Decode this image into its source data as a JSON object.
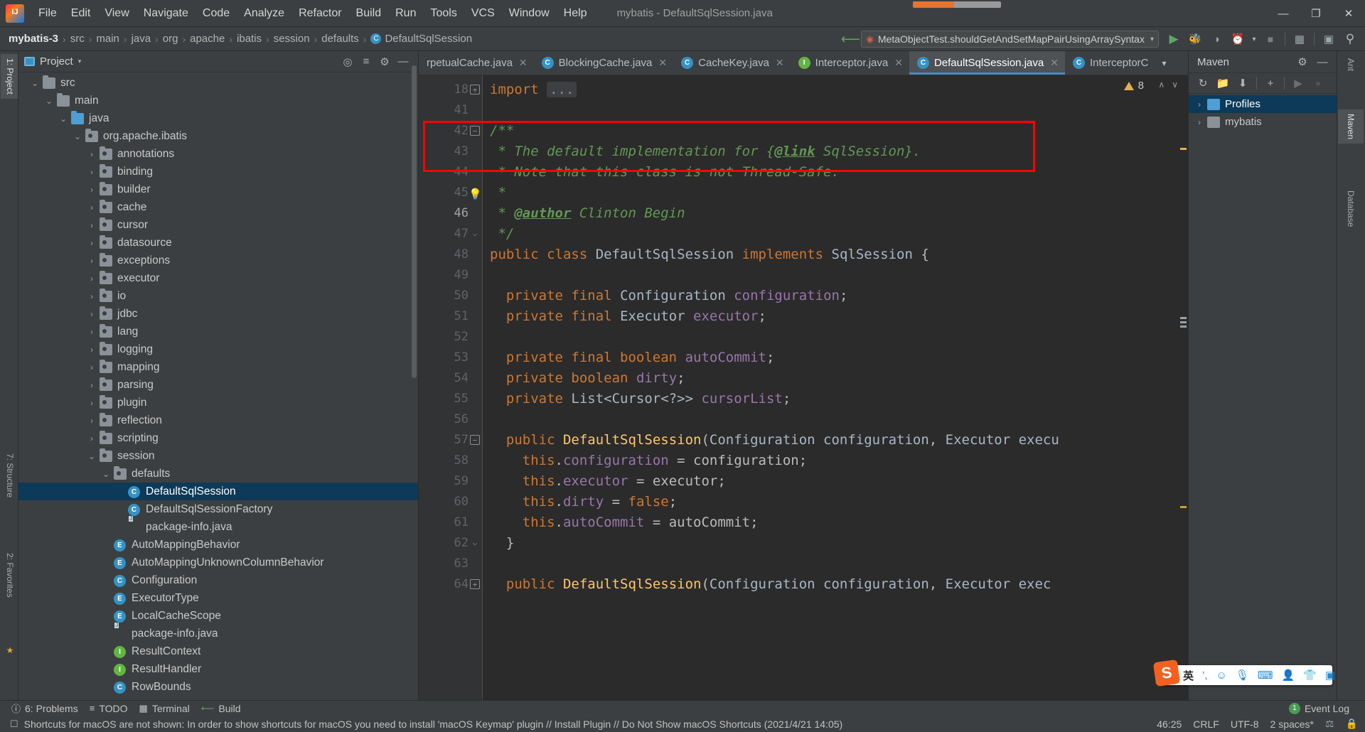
{
  "window": {
    "title": "mybatis - DefaultSqlSession.java",
    "buttons": {
      "minimize": "—",
      "maximize": "❐",
      "close": "✕"
    }
  },
  "menu": {
    "items": [
      "File",
      "Edit",
      "View",
      "Navigate",
      "Code",
      "Analyze",
      "Refactor",
      "Build",
      "Run",
      "Tools",
      "VCS",
      "Window",
      "Help"
    ]
  },
  "breadcrumb": {
    "items": [
      "mybatis-3",
      "src",
      "main",
      "java",
      "org",
      "apache",
      "ibatis",
      "session",
      "defaults",
      "DefaultSqlSession"
    ],
    "separator": "›",
    "class_badge": "C"
  },
  "run_config": {
    "name": "MetaObjectTest.shouldGetAndSetMapPairUsingArraySyntax",
    "caret": "▾"
  },
  "toolbar": {
    "run": "▶",
    "debug": "debug-bug-icon",
    "coverage": "run-with-coverage-icon",
    "profiler": "profiler-icon",
    "profiler_caret": "▾",
    "stop": "■",
    "project_structure": "project-structure-icon",
    "presentation": "▶",
    "search": "⌕"
  },
  "left_strip": {
    "tabs": [
      {
        "label": "1: Project",
        "active": true
      },
      {
        "label": "7: Structure",
        "active": false
      },
      {
        "label": "2: Favorites",
        "active": false
      },
      {
        "label": "★",
        "active": false
      }
    ]
  },
  "project_panel": {
    "title": "Project",
    "caret": "▾",
    "actions": [
      "target-icon",
      "collapse-all-icon",
      "settings-gear-icon",
      "hide-icon"
    ],
    "tree": [
      {
        "indent": 1,
        "arrow": "⌄",
        "icon": "folder",
        "label": "src",
        "type": "folder"
      },
      {
        "indent": 2,
        "arrow": "⌄",
        "icon": "folder",
        "label": "main",
        "type": "folder"
      },
      {
        "indent": 3,
        "arrow": "⌄",
        "icon": "folder-blue",
        "label": "java",
        "type": "folder-blue"
      },
      {
        "indent": 4,
        "arrow": "⌄",
        "icon": "package",
        "label": "org.apache.ibatis",
        "type": "package"
      },
      {
        "indent": 5,
        "arrow": "›",
        "icon": "package",
        "label": "annotations",
        "type": "package"
      },
      {
        "indent": 5,
        "arrow": "›",
        "icon": "package",
        "label": "binding",
        "type": "package"
      },
      {
        "indent": 5,
        "arrow": "›",
        "icon": "package",
        "label": "builder",
        "type": "package"
      },
      {
        "indent": 5,
        "arrow": "›",
        "icon": "package",
        "label": "cache",
        "type": "package"
      },
      {
        "indent": 5,
        "arrow": "›",
        "icon": "package",
        "label": "cursor",
        "type": "package"
      },
      {
        "indent": 5,
        "arrow": "›",
        "icon": "package",
        "label": "datasource",
        "type": "package"
      },
      {
        "indent": 5,
        "arrow": "›",
        "icon": "package",
        "label": "exceptions",
        "type": "package"
      },
      {
        "indent": 5,
        "arrow": "›",
        "icon": "package",
        "label": "executor",
        "type": "package"
      },
      {
        "indent": 5,
        "arrow": "›",
        "icon": "package",
        "label": "io",
        "type": "package"
      },
      {
        "indent": 5,
        "arrow": "›",
        "icon": "package",
        "label": "jdbc",
        "type": "package"
      },
      {
        "indent": 5,
        "arrow": "›",
        "icon": "package",
        "label": "lang",
        "type": "package"
      },
      {
        "indent": 5,
        "arrow": "›",
        "icon": "package",
        "label": "logging",
        "type": "package"
      },
      {
        "indent": 5,
        "arrow": "›",
        "icon": "package",
        "label": "mapping",
        "type": "package"
      },
      {
        "indent": 5,
        "arrow": "›",
        "icon": "package",
        "label": "parsing",
        "type": "package"
      },
      {
        "indent": 5,
        "arrow": "›",
        "icon": "package",
        "label": "plugin",
        "type": "package"
      },
      {
        "indent": 5,
        "arrow": "›",
        "icon": "package",
        "label": "reflection",
        "type": "package"
      },
      {
        "indent": 5,
        "arrow": "›",
        "icon": "package",
        "label": "scripting",
        "type": "package"
      },
      {
        "indent": 5,
        "arrow": "⌄",
        "icon": "package",
        "label": "session",
        "type": "package"
      },
      {
        "indent": 6,
        "arrow": "⌄",
        "icon": "package",
        "label": "defaults",
        "type": "package"
      },
      {
        "indent": 7,
        "arrow": "",
        "icon": "class",
        "label": "DefaultSqlSession",
        "type": "class",
        "selected": true
      },
      {
        "indent": 7,
        "arrow": "",
        "icon": "class",
        "label": "DefaultSqlSessionFactory",
        "type": "class"
      },
      {
        "indent": 7,
        "arrow": "",
        "icon": "javafile",
        "label": "package-info.java",
        "type": "javafile"
      },
      {
        "indent": 6,
        "arrow": "",
        "icon": "enum",
        "label": "AutoMappingBehavior",
        "type": "enum"
      },
      {
        "indent": 6,
        "arrow": "",
        "icon": "enum",
        "label": "AutoMappingUnknownColumnBehavior",
        "type": "enum"
      },
      {
        "indent": 6,
        "arrow": "",
        "icon": "class",
        "label": "Configuration",
        "type": "class"
      },
      {
        "indent": 6,
        "arrow": "",
        "icon": "enum",
        "label": "ExecutorType",
        "type": "enum"
      },
      {
        "indent": 6,
        "arrow": "",
        "icon": "enum",
        "label": "LocalCacheScope",
        "type": "enum"
      },
      {
        "indent": 6,
        "arrow": "",
        "icon": "javafile",
        "label": "package-info.java",
        "type": "javafile"
      },
      {
        "indent": 6,
        "arrow": "",
        "icon": "interface",
        "label": "ResultContext",
        "type": "interface"
      },
      {
        "indent": 6,
        "arrow": "",
        "icon": "interface",
        "label": "ResultHandler",
        "type": "interface"
      },
      {
        "indent": 6,
        "arrow": "",
        "icon": "class",
        "label": "RowBounds",
        "type": "class"
      }
    ]
  },
  "editor": {
    "tabs": [
      {
        "label": "rpetualCache.java",
        "badge": "C",
        "badge_color": "#3592c4",
        "active": false,
        "truncated": true
      },
      {
        "label": "BlockingCache.java",
        "badge": "C",
        "badge_color": "#3592c4",
        "active": false
      },
      {
        "label": "CacheKey.java",
        "badge": "C",
        "badge_color": "#3592c4",
        "active": false
      },
      {
        "label": "Interceptor.java",
        "badge": "I",
        "badge_color": "#62b543",
        "active": false
      },
      {
        "label": "DefaultSqlSession.java",
        "badge": "C",
        "badge_color": "#3592c4",
        "active": true
      },
      {
        "label": "InterceptorC",
        "badge": "C",
        "badge_color": "#3592c4",
        "active": false
      }
    ],
    "tab_overflow": "▾",
    "warning_count": "8",
    "nav_up": "∧",
    "nav_down": "∨",
    "lines": [
      {
        "num": "18",
        "fold": "plus",
        "html": "<span class=\"kw\">import</span> <span class=\"fold-ph\">...</span>"
      },
      {
        "num": "41",
        "fold": "",
        "html": ""
      },
      {
        "num": "42",
        "fold": "minus",
        "html": "<span class=\"cmt\">/**</span>"
      },
      {
        "num": "43",
        "fold": "",
        "html": "<span class=\"cmt\"> * The default implementation for {</span><span class=\"cmt-tag\">@link</span><span class=\"cmt\"> SqlSession}.</span>"
      },
      {
        "num": "44",
        "fold": "",
        "html": "<span class=\"cmt\"> * Note that this class is not Thread-Safe.</span>"
      },
      {
        "num": "45",
        "fold": "bulb",
        "html": "<span class=\"cmt\"> *</span>"
      },
      {
        "num": "46",
        "fold": "",
        "current": true,
        "html": "<span class=\"cmt\"> * </span><span class=\"cmt-tag\">@author</span><span class=\"cmt\"> Clinton Begin</span>"
      },
      {
        "num": "47",
        "fold": "end",
        "html": "<span class=\"cmt\"> */</span>"
      },
      {
        "num": "48",
        "fold": "",
        "html": "<span class=\"kw\">public class</span> <span class=\"typ\">DefaultSqlSession</span> <span class=\"kw\">implements</span> <span class=\"typ\">SqlSession</span> {"
      },
      {
        "num": "49",
        "fold": "",
        "html": ""
      },
      {
        "num": "50",
        "fold": "",
        "html": "  <span class=\"kw\">private final</span> <span class=\"typ\">Configuration</span> <span class=\"fld2\">configuration</span>;"
      },
      {
        "num": "51",
        "fold": "",
        "html": "  <span class=\"kw\">private final</span> <span class=\"typ\">Executor</span> <span class=\"fld2\">executor</span>;"
      },
      {
        "num": "52",
        "fold": "",
        "html": ""
      },
      {
        "num": "53",
        "fold": "",
        "html": "  <span class=\"kw\">private final boolean</span> <span class=\"fld2\">autoCommit</span>;"
      },
      {
        "num": "54",
        "fold": "",
        "html": "  <span class=\"kw\">private boolean</span> <span class=\"fld2\">dirty</span>;"
      },
      {
        "num": "55",
        "fold": "",
        "html": "  <span class=\"kw\">private</span> <span class=\"typ\">List&lt;Cursor&lt;?&gt;&gt;</span> <span class=\"fld2\">cursorList</span>;"
      },
      {
        "num": "56",
        "fold": "",
        "html": ""
      },
      {
        "num": "57",
        "fold": "minus",
        "html": "  <span class=\"kw\">public</span> <span class=\"mth\">DefaultSqlSession</span>(<span class=\"typ\">Configuration configuration</span>, <span class=\"typ\">Executor execu</span>"
      },
      {
        "num": "58",
        "fold": "",
        "html": "    <span class=\"kw\">this</span>.<span class=\"fld2\">configuration</span> = configuration;"
      },
      {
        "num": "59",
        "fold": "",
        "html": "    <span class=\"kw\">this</span>.<span class=\"fld2\">executor</span> = executor;"
      },
      {
        "num": "60",
        "fold": "",
        "html": "    <span class=\"kw\">this</span>.<span class=\"fld2\">dirty</span> = <span class=\"kw\">false</span>;"
      },
      {
        "num": "61",
        "fold": "",
        "html": "    <span class=\"kw\">this</span>.<span class=\"fld2\">autoCommit</span> = autoCommit;"
      },
      {
        "num": "62",
        "fold": "end",
        "html": "  }"
      },
      {
        "num": "63",
        "fold": "",
        "html": ""
      },
      {
        "num": "64",
        "fold": "plus",
        "html": "  <span class=\"kw\">public</span> <span class=\"mth\">DefaultSqlSession</span>(<span class=\"typ\">Configuration configuration</span>, <span class=\"typ\">Executor exec</span>"
      }
    ],
    "highlight_box": {
      "note": "red annotation rectangle around javadoc lines 43-44"
    }
  },
  "maven": {
    "title": "Maven",
    "actions": [
      "settings-gear-icon",
      "hide-icon"
    ],
    "toolbar": [
      "reimport-icon",
      "generate-sources-icon",
      "download-sources-icon",
      "add-icon",
      "run-icon",
      "expand-icon"
    ],
    "tree": [
      {
        "arrow": "›",
        "label": "Profiles",
        "icon": "profiles-icon",
        "selected": true
      },
      {
        "arrow": "›",
        "label": "mybatis",
        "icon": "maven-project-icon",
        "selected": false
      }
    ]
  },
  "right_strip": {
    "tabs": [
      {
        "label": "Ant",
        "active": false
      },
      {
        "label": "Maven",
        "active": true
      },
      {
        "label": "Database",
        "active": false
      }
    ]
  },
  "bottom_bar": {
    "items": [
      {
        "label": "6: Problems",
        "icon": "problems-icon",
        "mnemonic": "6"
      },
      {
        "label": "TODO",
        "icon": "todo-icon"
      },
      {
        "label": "Terminal",
        "icon": "terminal-icon"
      },
      {
        "label": "Build",
        "icon": "build-icon"
      }
    ],
    "event_log": {
      "label": "Event Log",
      "count": "1"
    }
  },
  "status_bar": {
    "message": "Shortcuts for macOS are not shown: In order to show shortcuts for macOS you need to install 'macOS Keymap' plugin // Install Plugin // Do Not Show macOS Shortcuts (2021/4/21 14:05)",
    "position": "46:25",
    "line_separator": "CRLF",
    "encoding": "UTF-8",
    "indent": "2 spaces*",
    "git_branch_icon": "git-icon",
    "lock_icon": "lock-icon"
  },
  "ime_bar": {
    "logo": "S",
    "items": [
      "英",
      "’,",
      "☺",
      "🎙",
      "⌨",
      "👤",
      "👕",
      "▣"
    ]
  },
  "colors": {
    "accent": "#4a88c7",
    "selection": "#0d3a58",
    "panel_bg": "#3c3f41",
    "editor_bg": "#2b2b2b",
    "highlight_red": "#ff0000"
  }
}
